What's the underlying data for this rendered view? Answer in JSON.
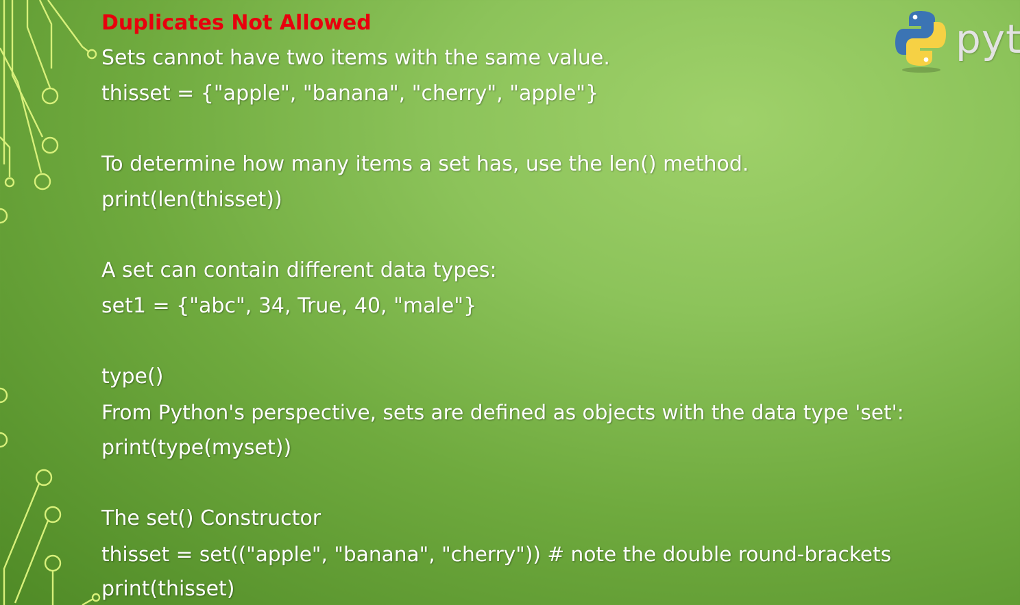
{
  "slide": {
    "heading": "Duplicates Not Allowed",
    "lines": [
      "Sets cannot have two items with the same value.",
      "thisset = {\"apple\", \"banana\", \"cherry\", \"apple\"}",
      "To determine how many items a set has, use the len() method.",
      "print(len(thisset))",
      "A set can contain different data types:",
      "set1 = {\"abc\", 34, True, 40, \"male\"}",
      "type()",
      "From Python's perspective, sets are defined as objects with the data type 'set':",
      "print(type(myset))",
      "The set() Constructor",
      "thisset = set((\"apple\", \"banana\", \"cherry\")) # note the double round-brackets",
      "print(thisset)"
    ]
  },
  "logo": {
    "text": "pyt",
    "icon": "python-logo-icon",
    "colors": {
      "blue": "#3b74b4",
      "yellow": "#f6d144"
    }
  },
  "colors": {
    "heading": "#e8000d",
    "body_text": "#ffffff",
    "circuit": "#d8f07a"
  },
  "decor": {
    "icon": "circuit-decoration-icon"
  }
}
